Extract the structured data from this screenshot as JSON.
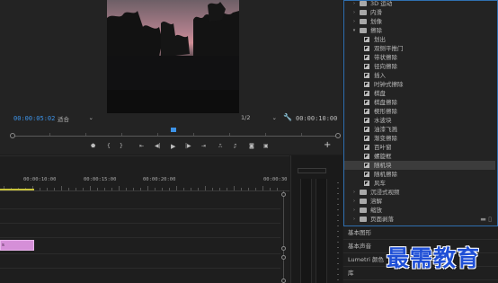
{
  "monitor": {
    "current_timecode": "00:00:05:02",
    "fit_value": "适合",
    "resolution_value": "1/2",
    "total_timecode": "00:00:10:00"
  },
  "timeline": {
    "ruler_labels": [
      "00:00:10:00",
      "00:00:15:00",
      "00:00:20:00",
      "00:00:30"
    ],
    "clip_label": "s"
  },
  "effects": {
    "rows": [
      {
        "type": "folder",
        "label": "3D 运动",
        "indent": 0
      },
      {
        "type": "folder",
        "label": "内滑",
        "indent": 0
      },
      {
        "type": "folder",
        "label": "划像",
        "indent": 0
      },
      {
        "type": "folder-open",
        "label": "擦除",
        "indent": 0
      },
      {
        "type": "effect",
        "label": "划出",
        "indent": 1
      },
      {
        "type": "effect",
        "label": "双侧平推门",
        "indent": 1
      },
      {
        "type": "effect",
        "label": "带状擦除",
        "indent": 1
      },
      {
        "type": "effect",
        "label": "径向擦除",
        "indent": 1
      },
      {
        "type": "effect",
        "label": "插入",
        "indent": 1
      },
      {
        "type": "effect",
        "label": "时钟式擦除",
        "indent": 1
      },
      {
        "type": "effect",
        "label": "棋盘",
        "indent": 1
      },
      {
        "type": "effect",
        "label": "棋盘擦除",
        "indent": 1
      },
      {
        "type": "effect",
        "label": "楔形擦除",
        "indent": 1
      },
      {
        "type": "effect",
        "label": "水波块",
        "indent": 1
      },
      {
        "type": "effect",
        "label": "油漆飞溅",
        "indent": 1
      },
      {
        "type": "effect",
        "label": "渐变擦除",
        "indent": 1
      },
      {
        "type": "effect",
        "label": "百叶窗",
        "indent": 1
      },
      {
        "type": "effect",
        "label": "螺旋框",
        "indent": 1
      },
      {
        "type": "effect",
        "label": "随机块",
        "indent": 1,
        "selected": true
      },
      {
        "type": "effect",
        "label": "随机擦除",
        "indent": 1
      },
      {
        "type": "effect",
        "label": "风车",
        "indent": 1
      },
      {
        "type": "folder",
        "label": "沉浸式视频",
        "indent": 0
      },
      {
        "type": "folder",
        "label": "溶解",
        "indent": 0
      },
      {
        "type": "folder",
        "label": "缩放",
        "indent": 0
      },
      {
        "type": "folder",
        "label": "页面剥落",
        "indent": 0
      }
    ]
  },
  "lower_panels": [
    "基本图形",
    "基本声音",
    "Lumetri 颜色",
    "库"
  ],
  "watermark": "最需教育",
  "colors": {
    "accent_blue": "#3d93e8",
    "clip_pink": "#d58fd8",
    "work_area_yellow": "#c8c23b",
    "panel_border": "#2f6fb0"
  }
}
